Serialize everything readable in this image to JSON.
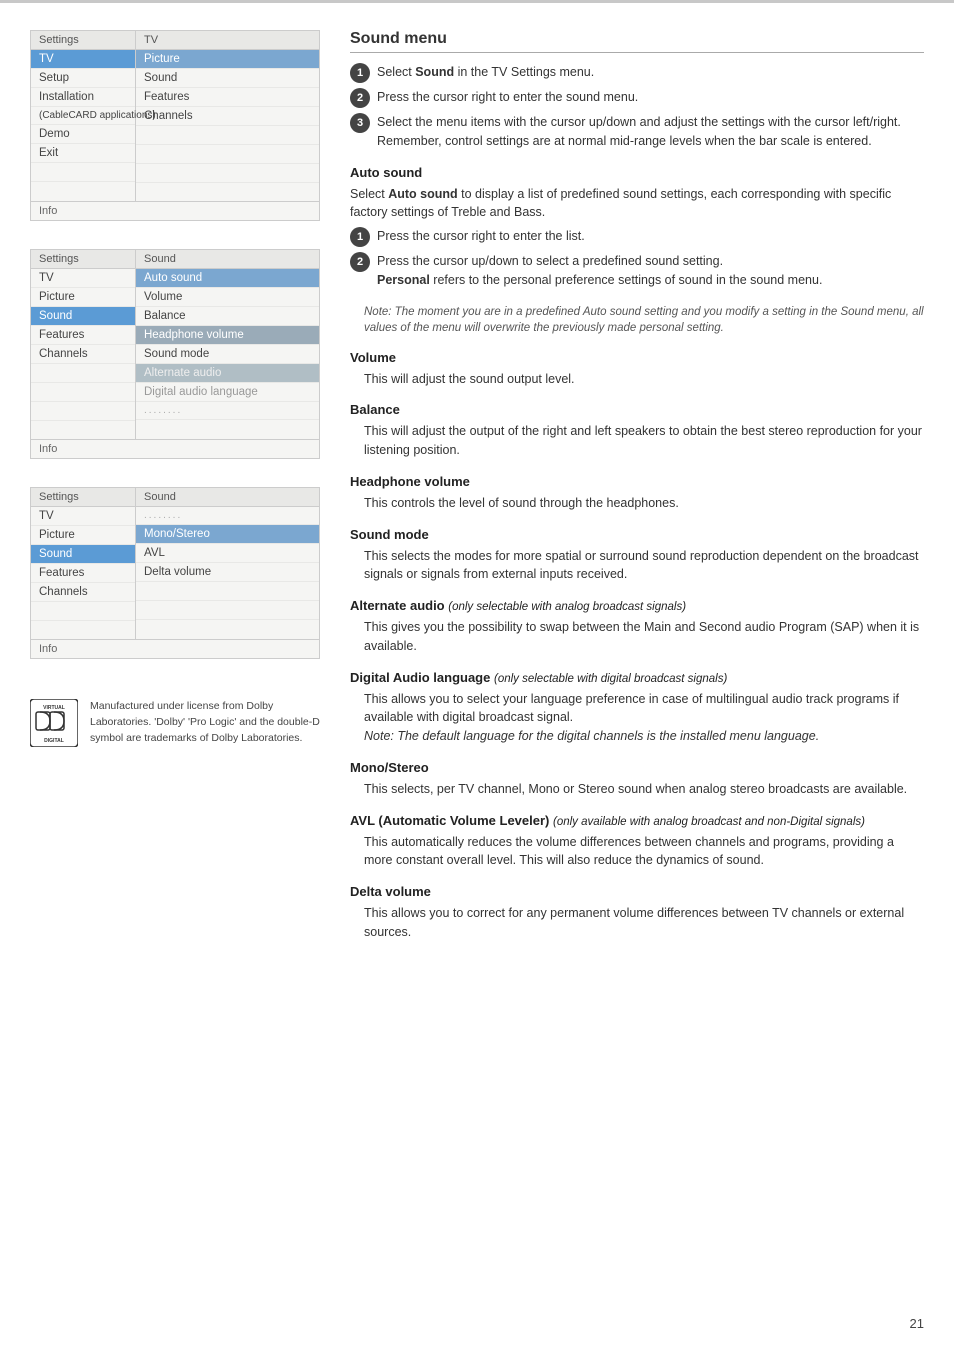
{
  "page": {
    "number": "21",
    "top_border_color": "#c8c8c8"
  },
  "menu_box_1": {
    "header_left": "Settings",
    "header_right": "TV",
    "left_items": [
      {
        "label": "TV",
        "style": "active-blue"
      },
      {
        "label": "Setup",
        "style": "normal"
      },
      {
        "label": "Installation",
        "style": "normal"
      },
      {
        "label": "(CableCARD applications)",
        "style": "normal"
      },
      {
        "label": "Demo",
        "style": "normal"
      },
      {
        "label": "Exit",
        "style": "normal"
      }
    ],
    "right_items": [
      {
        "label": "Picture",
        "style": "highlighted"
      },
      {
        "label": "Sound",
        "style": "normal"
      },
      {
        "label": "Features",
        "style": "normal"
      },
      {
        "label": "Channels",
        "style": "normal"
      }
    ],
    "footer": "Info"
  },
  "menu_box_2": {
    "header_left": "Settings",
    "left_items": [
      {
        "label": "TV",
        "style": "normal"
      },
      {
        "label": "Picture",
        "style": "normal"
      },
      {
        "label": "Sound",
        "style": "active-blue"
      },
      {
        "label": "Features",
        "style": "normal"
      },
      {
        "label": "Channels",
        "style": "normal"
      }
    ],
    "header_right": "Sound",
    "right_items": [
      {
        "label": "Auto sound",
        "style": "highlighted"
      },
      {
        "label": "Volume",
        "style": "normal"
      },
      {
        "label": "Balance",
        "style": "normal"
      },
      {
        "label": "Headphone volume",
        "style": "dark-gray"
      },
      {
        "label": "Sound mode",
        "style": "normal"
      },
      {
        "label": "Alternate audio",
        "style": "medium-gray"
      },
      {
        "label": "Digital audio language",
        "style": "grayed"
      },
      {
        "label": "........",
        "style": "dots"
      }
    ],
    "footer": "Info"
  },
  "menu_box_3": {
    "header_left": "Settings",
    "left_items": [
      {
        "label": "TV",
        "style": "normal"
      },
      {
        "label": "Picture",
        "style": "normal"
      },
      {
        "label": "Sound",
        "style": "active-blue"
      },
      {
        "label": "Features",
        "style": "normal"
      },
      {
        "label": "Channels",
        "style": "normal"
      }
    ],
    "header_right": "Sound",
    "right_items": [
      {
        "label": "........",
        "style": "dots-top"
      },
      {
        "label": "Mono/Stereo",
        "style": "highlighted"
      },
      {
        "label": "AVL",
        "style": "normal"
      },
      {
        "label": "Delta volume",
        "style": "normal"
      }
    ],
    "footer": "Info"
  },
  "content": {
    "main_title": "Sound menu",
    "steps_intro": [
      {
        "num": "1",
        "text": "Select <strong>Sound</strong> in the TV Settings menu."
      },
      {
        "num": "2",
        "text": "Press the cursor right to enter the sound menu."
      },
      {
        "num": "3",
        "text": "Select the menu items with the cursor up/down and adjust the settings with the cursor left/right.<br>Remember, control settings are at normal mid-range levels when the bar scale is entered."
      }
    ],
    "auto_sound": {
      "title": "Auto sound",
      "body": "Select <strong>Auto sound</strong> to display a list of predefined sound settings, each corresponding with specific factory settings of Treble and Bass.",
      "steps": [
        {
          "num": "1",
          "text": "Press the cursor right to enter the list."
        },
        {
          "num": "2",
          "text": "Press the cursor up/down to select a predefined sound setting.<br><strong>Personal</strong> refers to the personal preference settings of sound in the sound menu."
        }
      ],
      "note": "Note: The moment you are in a predefined Auto sound setting and you modify a setting in the Sound menu, all values of the menu will overwrite the previously made personal setting."
    },
    "volume": {
      "title": "Volume",
      "body": "This will adjust the sound output level."
    },
    "balance": {
      "title": "Balance",
      "body": "This will adjust the output of the right and left speakers to obtain the best stereo reproduction for your listening position."
    },
    "headphone": {
      "title": "Headphone volume",
      "body": "This controls the level of sound through the headphones."
    },
    "sound_mode": {
      "title": "Sound mode",
      "body": "This selects the modes for more spatial or surround sound reproduction dependent on the broadcast signals or signals from external inputs received."
    },
    "alternate_audio": {
      "title": "Alternate audio",
      "qualifier": "(only selectable with analog broadcast signals)",
      "body": "This gives you the possibility to swap between the Main and Second audio Program (SAP) when it is available."
    },
    "digital_audio": {
      "title": "Digital Audio language",
      "qualifier": "(only selectable with digital broadcast signals)",
      "body": "This allows you to select your language preference in case of multilingual audio track programs if available with digital broadcast signal.",
      "note": "Note: The default language for the digital channels is the installed menu language."
    },
    "mono_stereo": {
      "title": "Mono/Stereo",
      "body": "This selects, per TV channel, Mono or Stereo sound when analog stereo broadcasts are available."
    },
    "avl": {
      "title": "AVL (Automatic Volume Leveler)",
      "qualifier": "(only available with analog broadcast and non-Digital signals)",
      "body": "This automatically reduces the volume differences between channels and programs, providing a more constant overall level. This will also reduce the dynamics of sound."
    },
    "delta_volume": {
      "title": "Delta volume",
      "body": "This allows you to correct for any permanent volume differences between TV channels or external sources."
    }
  },
  "dolby": {
    "text": "Manufactured under license from Dolby Laboratories.\n'Dolby' 'Pro Logic' and the double-D symbol are\ntrademarks of Dolby Laboratories."
  }
}
